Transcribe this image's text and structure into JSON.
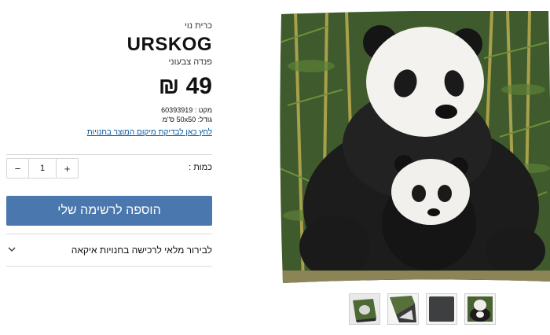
{
  "product": {
    "category": "כרית נוי",
    "name": "URSKOG",
    "description": "פנדה צבעוני",
    "price": "49 ₪",
    "sku": "מקט : 60393919",
    "size": "גודל: 50x50 ס\"מ",
    "store_link": "לחץ כאן לבדיקת מיקום המוצר בחנויות"
  },
  "quantity": {
    "label": "כמות :",
    "value": "1",
    "minus": "−",
    "plus": "+"
  },
  "actions": {
    "add_to_list": "הוספה לרשימה שלי",
    "availability": "לבירור מלאי לרכישה בחנויות איקאה"
  },
  "colors": {
    "accent": "#4a77ad",
    "link": "#0058a3"
  },
  "gallery": {
    "main_image": "panda-cushion-photo",
    "thumbnails": [
      "cushion-side-view",
      "cushion-corner-view",
      "cushion-back-dark",
      "cushion-front-panda"
    ]
  }
}
